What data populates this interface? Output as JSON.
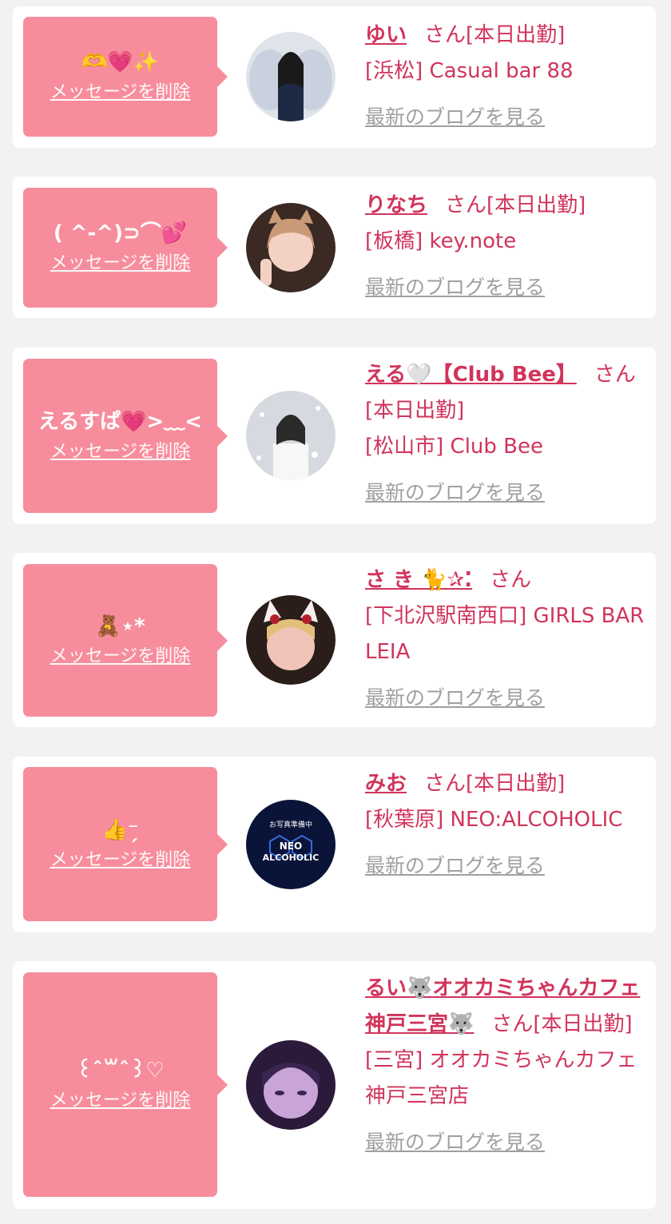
{
  "theme": {
    "accent": "#d1345b",
    "bubble": "#f78d9c",
    "background": "#f2f2f2",
    "link_gray": "#a0a0a0"
  },
  "common": {
    "delete_label": "メッセージを削除",
    "san": "さん",
    "blog_label": "最新のブログを見る"
  },
  "cards": [
    {
      "message": "🫶💗✨",
      "name": "ゆい",
      "status": "[本日出勤]",
      "shop": "[浜松] Casual bar 88"
    },
    {
      "message": "( ^-^)⊃⌒💕",
      "name": "りなち",
      "status": "[本日出勤]",
      "shop": "[板橋] key.note"
    },
    {
      "message": "えるすぱ💗>﹏<",
      "name": "える🤍【Club Bee】",
      "status": "[本日出勤]",
      "shop": "[松山市] Club Bee"
    },
    {
      "message": "🧸⋆*",
      "name": "さ き 🐈✰⁚",
      "status": "",
      "shop": "[下北沢駅南西口] GIRLS BAR LEIA"
    },
    {
      "message": "👍⁻̗",
      "name": "みお",
      "status": "[本日出勤]",
      "shop": "[秋葉原] NEO:ALCOHOLIC",
      "avatar_text": [
        "お写真準備中",
        "NEO",
        "ALCOHOLIC"
      ]
    },
    {
      "message": "꒰ˆ꒳ˆ꒱♡",
      "name": "るい🐺オオカミちゃんカフェ神戸三宮🐺",
      "status": "[本日出勤]",
      "shop": "[三宮] オオカミちゃんカフェ神戸三宮店"
    }
  ]
}
